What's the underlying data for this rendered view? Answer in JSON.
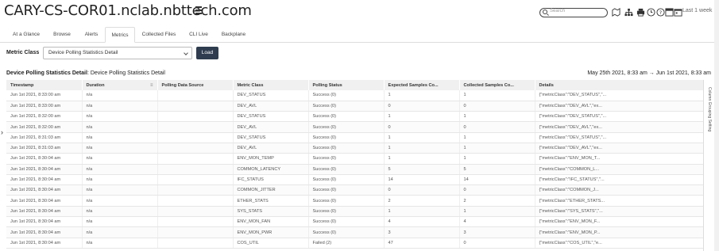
{
  "header": {
    "title": "CARY-CS-COR01.nclab.nbttech.com",
    "search_placeholder": "Search",
    "time_range": "Last 1 week"
  },
  "tabs": [
    {
      "label": "At a Glance"
    },
    {
      "label": "Browse"
    },
    {
      "label": "Alerts"
    },
    {
      "label": "Metrics"
    },
    {
      "label": "Collected Files"
    },
    {
      "label": "CLI Live"
    },
    {
      "label": "Backplane"
    }
  ],
  "metric_class": {
    "label": "Metric Class",
    "selected": "Device Polling Statistics Detail",
    "load_label": "Load"
  },
  "detail": {
    "heading_bold": "Device Polling Statistics Detail",
    "heading_rest": ": Device Polling Statistics Detail",
    "date_range": "May 25th 2021, 8:33 am → Jun 1st 2021, 8:33 am"
  },
  "table": {
    "columns": [
      "Timestamp",
      "Duration",
      "Polling Data Source",
      "Metric Class",
      "Polling Status",
      "Expected Samples Co...",
      "Collected Samples Co...",
      "Details"
    ],
    "rows": [
      [
        "Jun 1st 2021, 8:33:00 am",
        "n/a",
        "",
        "DEV_STATUS",
        "Success (0)",
        "1",
        "1",
        "{\"metricClass\":\"DEV_STATUS\",\"..."
      ],
      [
        "Jun 1st 2021, 8:33:00 am",
        "n/a",
        "",
        "DEV_AVL",
        "Success (0)",
        "0",
        "0",
        "{\"metricClass\":\"DEV_AVL\",\"ex..."
      ],
      [
        "Jun 1st 2021, 8:32:00 am",
        "n/a",
        "",
        "DEV_STATUS",
        "Success (0)",
        "1",
        "1",
        "{\"metricClass\":\"DEV_STATUS\",\"..."
      ],
      [
        "Jun 1st 2021, 8:32:00 am",
        "n/a",
        "",
        "DEV_AVL",
        "Success (0)",
        "0",
        "0",
        "{\"metricClass\":\"DEV_AVL\",\"ex..."
      ],
      [
        "Jun 1st 2021, 8:31:03 am",
        "n/a",
        "",
        "DEV_STATUS",
        "Success (0)",
        "1",
        "1",
        "{\"metricClass\":\"DEV_STATUS\",\"..."
      ],
      [
        "Jun 1st 2021, 8:31:03 am",
        "n/a",
        "",
        "DEV_AVL",
        "Success (0)",
        "1",
        "1",
        "{\"metricClass\":\"DEV_AVL\",\"ex..."
      ],
      [
        "Jun 1st 2021, 8:30:04 am",
        "n/a",
        "",
        "ENV_MON_TEMP",
        "Success (0)",
        "1",
        "1",
        "{\"metricClass\":\"ENV_MON_T..."
      ],
      [
        "Jun 1st 2021, 8:30:04 am",
        "n/a",
        "",
        "COMMON_LATENCY",
        "Success (0)",
        "5",
        "5",
        "{\"metricClass\":\"COMMON_L..."
      ],
      [
        "Jun 1st 2021, 8:30:04 am",
        "n/a",
        "",
        "IFC_STATUS",
        "Success (0)",
        "14",
        "14",
        "{\"metricClass\":\"IFC_STATUS\",\"..."
      ],
      [
        "Jun 1st 2021, 8:30:04 am",
        "n/a",
        "",
        "COMMON_JITTER",
        "Success (0)",
        "0",
        "0",
        "{\"metricClass\":\"COMMON_J..."
      ],
      [
        "Jun 1st 2021, 8:30:04 am",
        "n/a",
        "",
        "ETHER_STATS",
        "Success (0)",
        "2",
        "2",
        "{\"metricClass\":\"ETHER_STATS..."
      ],
      [
        "Jun 1st 2021, 8:30:04 am",
        "n/a",
        "",
        "SYS_STATS",
        "Success (0)",
        "1",
        "1",
        "{\"metricClass\":\"SYS_STATS\",\"..."
      ],
      [
        "Jun 1st 2021, 8:30:04 am",
        "n/a",
        "",
        "ENV_MON_FAN",
        "Success (0)",
        "4",
        "4",
        "{\"metricClass\":\"ENV_MON_F..."
      ],
      [
        "Jun 1st 2021, 8:30:04 am",
        "n/a",
        "",
        "ENV_MON_PWR",
        "Success (0)",
        "3",
        "3",
        "{\"metricClass\":\"ENV_MON_P..."
      ],
      [
        "Jun 1st 2021, 8:30:04 am",
        "n/a",
        "",
        "COS_UTIL",
        "Failed (2)",
        "47",
        "0",
        "{\"metricClass\":\"COS_UTIL\",\"e..."
      ]
    ]
  },
  "side_panel": {
    "label": "Column Grouping Setting"
  }
}
